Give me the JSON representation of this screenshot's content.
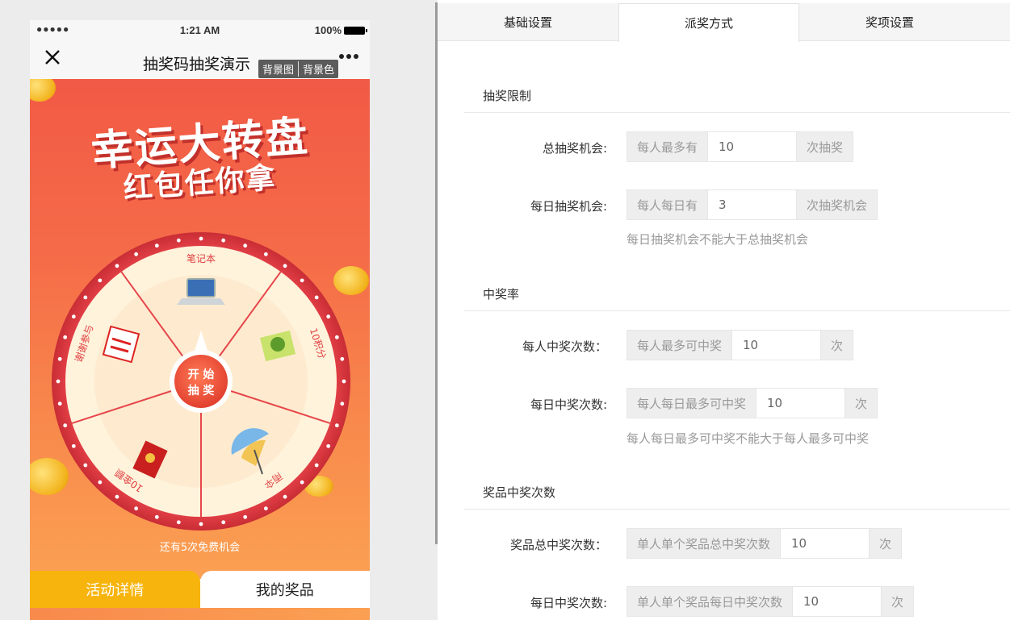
{
  "status_bar": {
    "signal": "●●●●●",
    "time": "1:21 AM",
    "battery": "100%"
  },
  "preview": {
    "title": "抽奖码抽奖演示",
    "bg_image_btn": "背景图",
    "bg_color_btn": "背景色",
    "banner_title": "幸运大转盘",
    "banner_subtitle": "红包任你拿",
    "wheel": {
      "prizes": [
        "笔记本",
        "10积分",
        "雨伞",
        "10金额",
        "谢谢参与"
      ],
      "start_line1": "开 始",
      "start_line2": "抽 奖",
      "colors": {
        "rim": "#e9434a",
        "slice_light": "#fff3dc",
        "slice_inner": "#fde6c8",
        "divider": "#e6464b",
        "label": "#e03d3f"
      }
    },
    "free_chances": "还有5次免费机会",
    "tabs": [
      {
        "label": "活动详情"
      },
      {
        "label": "我的奖品"
      }
    ]
  },
  "settings": {
    "tabs": [
      {
        "label": "基础设置"
      },
      {
        "label": "派奖方式"
      },
      {
        "label": "奖项设置"
      }
    ],
    "sections": {
      "limit": {
        "title": "抽奖限制",
        "total": {
          "label": "总抽奖机会:",
          "prefix": "每人最多有",
          "value": "10",
          "suffix": "次抽奖"
        },
        "daily": {
          "label": "每日抽奖机会:",
          "prefix": "每人每日有",
          "value": "3",
          "suffix": "次抽奖机会"
        },
        "hint": "每日抽奖机会不能大于总抽奖机会"
      },
      "rate": {
        "title": "中奖率",
        "per_person": {
          "label": "每人中奖次数：",
          "prefix": "每人最多可中奖",
          "value": "10",
          "suffix": "次"
        },
        "per_day": {
          "label": "每日中奖次数:",
          "prefix": "每人每日最多可中奖",
          "value": "10",
          "suffix": "次"
        },
        "hint": "每人每日最多可中奖不能大于每人最多可中奖"
      },
      "prize_count": {
        "title": "奖品中奖次数",
        "total": {
          "label": "奖品总中奖次数：",
          "prefix": "单人单个奖品总中奖次数",
          "value": "10",
          "suffix": "次"
        },
        "daily": {
          "label": "每日中奖次数:",
          "prefix": "单人单个奖品每日中奖次数",
          "value": "10",
          "suffix": "次"
        }
      }
    }
  }
}
